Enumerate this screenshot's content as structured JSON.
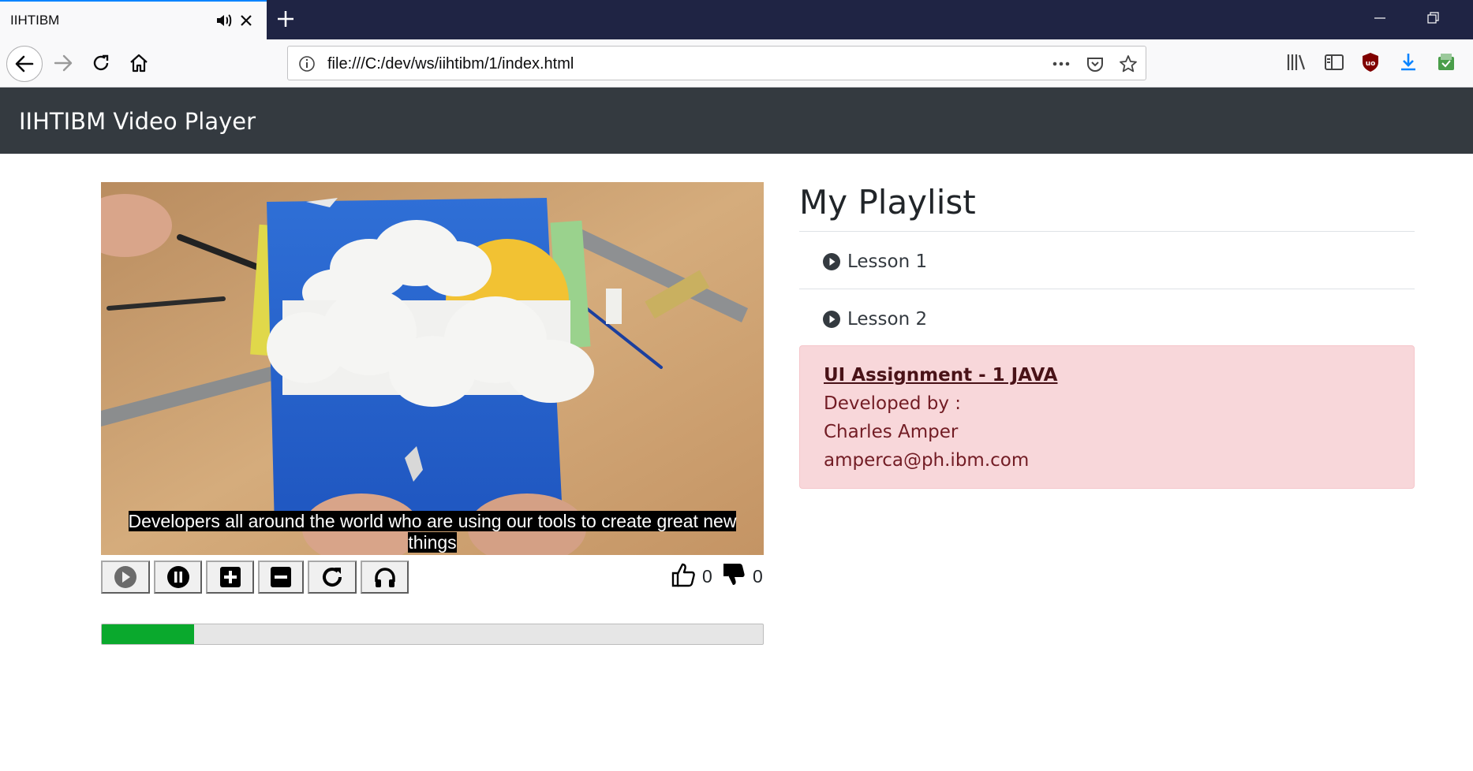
{
  "browser": {
    "tab_title": "IIHTIBM",
    "url": "file:///C:/dev/ws/iihtibm/1/index.html"
  },
  "app": {
    "brand": "IIHTIBM Video Player"
  },
  "video": {
    "caption_line1": "Developers all around the world who are using our tools to create great new",
    "caption_line2": "things",
    "progress_fraction": 0.14
  },
  "controls": {
    "buttons": [
      "play-icon",
      "pause-icon",
      "plus-icon",
      "minus-icon",
      "reload-icon",
      "headphones-icon"
    ]
  },
  "votes": {
    "likes": "0",
    "dislikes": "0"
  },
  "playlist": {
    "title": "My Playlist",
    "items": [
      {
        "label": "Lesson 1"
      },
      {
        "label": "Lesson 2"
      }
    ]
  },
  "info": {
    "link": "UI Assignment - 1 JAVA",
    "developed_by": "Developed by :",
    "name": "Charles Amper",
    "email": "amperca@ph.ibm.com"
  },
  "colors": {
    "header_bg": "#343a40",
    "progress": "#0aa92d",
    "alert_bg": "#f8d7da",
    "alert_text": "#721c24"
  }
}
